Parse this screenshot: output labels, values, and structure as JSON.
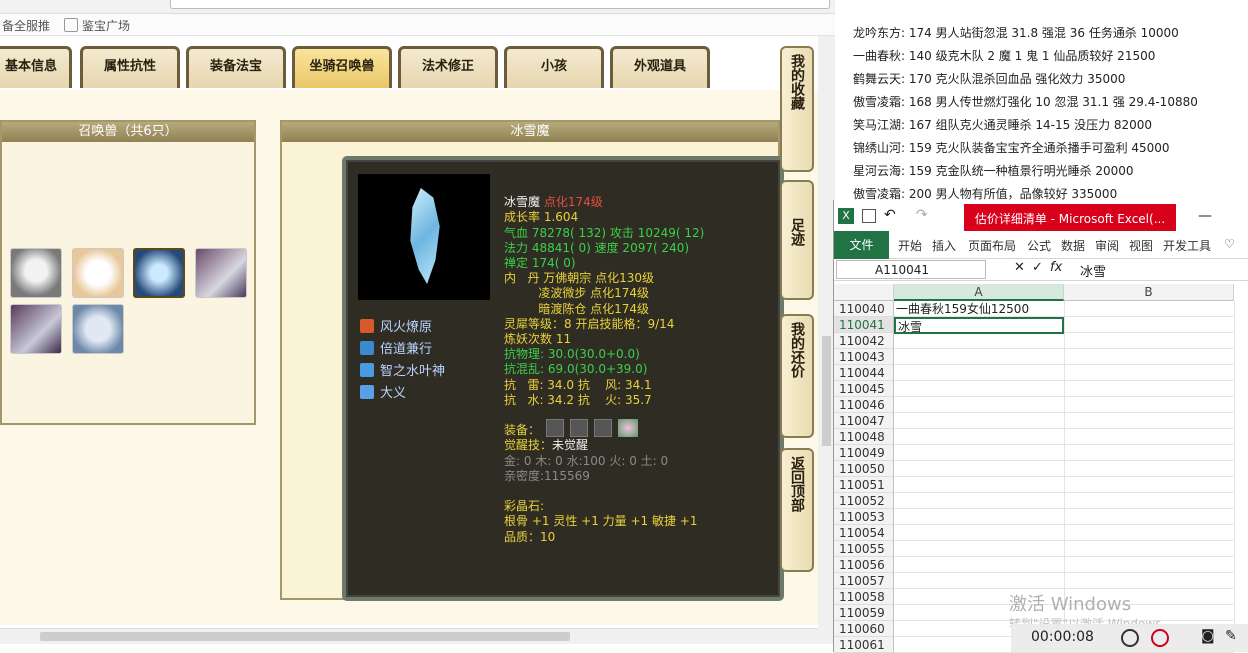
{
  "browser": {
    "bookmarks": [
      "备全服推",
      "鉴宝广场"
    ]
  },
  "game": {
    "tabs": [
      "基本信息",
      "属性抗性",
      "装备法宝",
      "坐骑召唤兽",
      "法术修正",
      "小孩",
      "外观道具"
    ],
    "active_tab": "坐骑召唤兽",
    "summon_panel_title": "召唤兽（共6只）",
    "detail_panel_title": "冰雪魔",
    "pet": {
      "name": "冰雪魔",
      "evolve": "点化174级",
      "growth_label": "成长率",
      "growth": "1.604",
      "hp_line": "气血 78278( 132) 攻击 10249( 12)",
      "mp_line": "法力 48841( 0) 速度 2097( 240)",
      "zen_line": "禅定 174( 0)",
      "dan_line1": "内   丹 万佛朝宗 点化130级",
      "dan_line2": "         凌波微步 点化174级",
      "dan_line3": "         暗渡陈仓 点化174级",
      "level_line": "灵犀等级：8 开启技能格：9/14",
      "refine_line": "炼妖次数 11",
      "phys_line": "抗物理: 30.0(30.0+0.0)",
      "chaos_line": "抗混乱: 69.0(30.0+39.0)",
      "thunder_line": "抗   雷: 34.0 抗    风: 34.1",
      "water_line": "抗   水: 34.2 抗    火: 35.7",
      "equip_label": "装备：",
      "awaken_label": "觉醒技：",
      "awaken_value": "未觉醒",
      "elements_line": "金: 0 木: 0 水:100 火: 0 土: 0",
      "intimacy_line": "亲密度:115569",
      "gem_label": "彩晶石:",
      "gem_line": "根骨 +1 灵性 +1 力量 +1 敏捷 +1",
      "quality_line": "品质：10"
    },
    "skills": [
      "风火燎原",
      "倍道兼行",
      "智之水叶神",
      "大义"
    ],
    "side_buttons": [
      "我的收藏",
      "足迹",
      "我的还价",
      "返回顶部"
    ]
  },
  "notes": [
    "龙吟东方: 174 男人站街忽混 31.8 强混 36 任务通杀 10000",
    "一曲春秋: 140 级克木队 2 魔 1 鬼 1 仙品质较好 21500",
    "鹤舞云天: 170 克火队混杀回血品 强化效力 35000",
    "傲雪凌霜: 168 男人传世燃灯强化 10 忽混 31.1 强 29.4-10880",
    "笑马江湖: 167 组队克火通灵睡杀 14-15 没压力 82000",
    "锦绣山河: 159 克火队装备宝宝齐全通杀播手可盈利 45000",
    "星河云海: 159 克金队统一种植景行明光睡杀 20000",
    "傲雪凌霜: 200 男人物有所值，品像较好 335000"
  ],
  "excel": {
    "title": "估价详细清单 - Microsoft Excel(...",
    "ribbon": [
      "文件",
      "开始",
      "插入",
      "页面布局",
      "公式",
      "数据",
      "审阅",
      "视图",
      "开发工具"
    ],
    "namebox": "A110041",
    "formula_value": "冰雪",
    "columns": [
      "A",
      "B"
    ],
    "rows": [
      {
        "num": "110040",
        "a": "一曲春秋159女仙12500"
      },
      {
        "num": "110041",
        "a": "冰雪"
      },
      {
        "num": "110042",
        "a": ""
      },
      {
        "num": "110043",
        "a": ""
      },
      {
        "num": "110044",
        "a": ""
      },
      {
        "num": "110045",
        "a": ""
      },
      {
        "num": "110046",
        "a": ""
      },
      {
        "num": "110047",
        "a": ""
      },
      {
        "num": "110048",
        "a": ""
      },
      {
        "num": "110049",
        "a": ""
      },
      {
        "num": "110050",
        "a": ""
      },
      {
        "num": "110051",
        "a": ""
      },
      {
        "num": "110052",
        "a": ""
      },
      {
        "num": "110053",
        "a": ""
      },
      {
        "num": "110054",
        "a": ""
      },
      {
        "num": "110055",
        "a": ""
      },
      {
        "num": "110056",
        "a": ""
      },
      {
        "num": "110057",
        "a": ""
      },
      {
        "num": "110058",
        "a": ""
      },
      {
        "num": "110059",
        "a": ""
      },
      {
        "num": "110060",
        "a": ""
      },
      {
        "num": "110061",
        "a": ""
      }
    ],
    "watermark": "激活 Windows",
    "watermark_sub": "转到\"设置\"以激活 Windows。"
  },
  "recorder": {
    "time": "00:00:08"
  }
}
